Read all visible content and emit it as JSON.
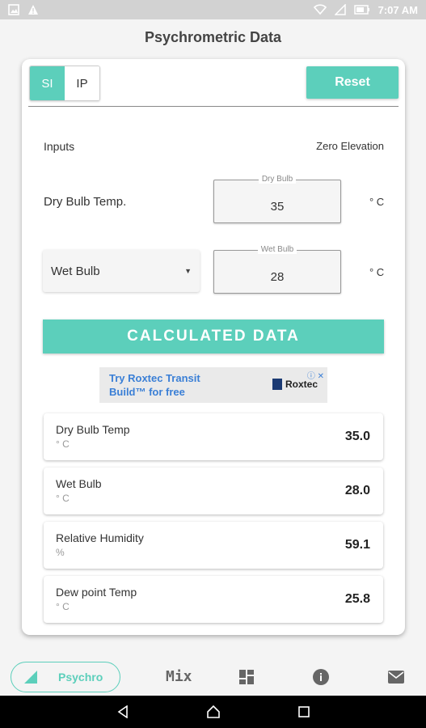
{
  "status_bar": {
    "time": "7:07 AM",
    "left_icons": [
      "image-icon",
      "warning-icon"
    ],
    "right_icons": [
      "wifi-icon",
      "signal-icon",
      "battery-icon"
    ]
  },
  "app": {
    "title": "Psychrometric Data"
  },
  "unit_toggle": {
    "si_label": "SI",
    "ip_label": "IP",
    "selected": "SI"
  },
  "reset_label": "Reset",
  "inputs": {
    "section_label": "Inputs",
    "elevation_label": "Zero Elevation",
    "dry_bulb": {
      "row_label": "Dry Bulb Temp.",
      "field_label": "Dry Bulb",
      "value": "35",
      "unit": "° C"
    },
    "second": {
      "dropdown_value": "Wet Bulb",
      "field_label": "Wet Bulb",
      "value": "28",
      "unit": "° C"
    }
  },
  "calculated_header": "CALCULATED DATA",
  "ad": {
    "text_line1": "Try Roxtec Transit",
    "text_line2": "Build™ for free",
    "brand": "Roxtec",
    "choices_label": "ⓘ ✕"
  },
  "results": [
    {
      "label": "Dry Bulb Temp",
      "unit": "° C",
      "value": "35.0"
    },
    {
      "label": "Wet Bulb",
      "unit": "° C",
      "value": "28.0"
    },
    {
      "label": "Relative Humidity",
      "unit": "%",
      "value": "59.1"
    },
    {
      "label": "Dew point Temp",
      "unit": "° C",
      "value": "25.8"
    }
  ],
  "bottom_nav": {
    "active_label": "Psychro",
    "mix_label": "Mix",
    "icons": [
      "psychro-icon",
      "mix-icon",
      "dashboard-icon",
      "info-icon",
      "mail-icon"
    ]
  },
  "colors": {
    "accent": "#5ccfbb",
    "ad_text": "#3a7fd6",
    "status_bar": "#d2d2d2",
    "system_bar": "#000000"
  }
}
